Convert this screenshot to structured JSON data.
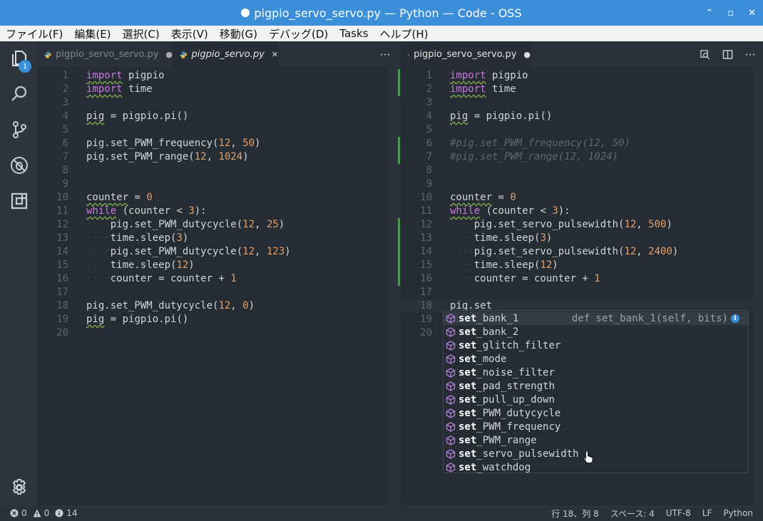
{
  "window": {
    "title": "pigpio_servo_servo.py — Python — Code - OSS",
    "controls": [
      "⌃",
      "▫",
      "✕"
    ]
  },
  "menu": [
    "ファイル(F)",
    "編集(E)",
    "選択(C)",
    "表示(V)",
    "移動(G)",
    "デバッグ(D)",
    "Tasks",
    "ヘルプ(H)"
  ],
  "activity": {
    "explorer_badge": "1"
  },
  "left_group": {
    "tabs": [
      {
        "label": "pigpio_servo_servo.py",
        "state": "●",
        "active": false
      },
      {
        "label": "pigpio_servo.py",
        "state": "✕",
        "active": true
      }
    ],
    "more": "···",
    "lines": [
      {
        "n": "1",
        "segs": [
          {
            "t": "import",
            "c": "kw sq"
          },
          {
            "t": " pigpio",
            "c": ""
          }
        ]
      },
      {
        "n": "2",
        "segs": [
          {
            "t": "import",
            "c": "kw sq"
          },
          {
            "t": " time",
            "c": ""
          }
        ]
      },
      {
        "n": "3",
        "segs": []
      },
      {
        "n": "4",
        "segs": [
          {
            "t": "pig",
            "c": "sq"
          },
          {
            "t": " = pigpio.pi()",
            "c": ""
          }
        ]
      },
      {
        "n": "5",
        "segs": []
      },
      {
        "n": "6",
        "segs": [
          {
            "t": "pig.set_PWM_frequency(",
            "c": ""
          },
          {
            "t": "12",
            "c": "num"
          },
          {
            "t": ", ",
            "c": ""
          },
          {
            "t": "50",
            "c": "num"
          },
          {
            "t": ")",
            "c": ""
          }
        ]
      },
      {
        "n": "7",
        "segs": [
          {
            "t": "pig.set_PWM_range(",
            "c": ""
          },
          {
            "t": "12",
            "c": "num"
          },
          {
            "t": ", ",
            "c": ""
          },
          {
            "t": "1024",
            "c": "num"
          },
          {
            "t": ")",
            "c": ""
          }
        ]
      },
      {
        "n": "8",
        "segs": []
      },
      {
        "n": "9",
        "segs": []
      },
      {
        "n": "10",
        "segs": [
          {
            "t": "counter",
            "c": "sq"
          },
          {
            "t": " = ",
            "c": ""
          },
          {
            "t": "0",
            "c": "num"
          }
        ]
      },
      {
        "n": "11",
        "segs": [
          {
            "t": "while",
            "c": "kw sq"
          },
          {
            "t": " (counter < ",
            "c": ""
          },
          {
            "t": "3",
            "c": "num"
          },
          {
            "t": "):",
            "c": ""
          }
        ]
      },
      {
        "n": "12",
        "segs": [
          {
            "t": "····",
            "c": "indent-guide"
          },
          {
            "t": "pig.set_PWM_dutycycle(",
            "c": ""
          },
          {
            "t": "12",
            "c": "num"
          },
          {
            "t": ", ",
            "c": ""
          },
          {
            "t": "25",
            "c": "num"
          },
          {
            "t": ")",
            "c": ""
          }
        ]
      },
      {
        "n": "13",
        "segs": [
          {
            "t": "····",
            "c": "indent-guide"
          },
          {
            "t": "time.sleep(",
            "c": ""
          },
          {
            "t": "3",
            "c": "num"
          },
          {
            "t": ")",
            "c": ""
          }
        ]
      },
      {
        "n": "14",
        "segs": [
          {
            "t": "····",
            "c": "indent-guide"
          },
          {
            "t": "pig.set_PWM_dutycycle(",
            "c": ""
          },
          {
            "t": "12",
            "c": "num"
          },
          {
            "t": ", ",
            "c": ""
          },
          {
            "t": "123",
            "c": "num"
          },
          {
            "t": ")",
            "c": ""
          }
        ]
      },
      {
        "n": "15",
        "segs": [
          {
            "t": "····",
            "c": "indent-guide"
          },
          {
            "t": "time.sleep(",
            "c": ""
          },
          {
            "t": "12",
            "c": "num"
          },
          {
            "t": ")",
            "c": ""
          }
        ]
      },
      {
        "n": "16",
        "segs": [
          {
            "t": "····",
            "c": "indent-guide"
          },
          {
            "t": "counter = counter + ",
            "c": ""
          },
          {
            "t": "1",
            "c": "num"
          }
        ]
      },
      {
        "n": "17",
        "segs": []
      },
      {
        "n": "18",
        "segs": [
          {
            "t": "pig.set_PWM_dutycycle(",
            "c": ""
          },
          {
            "t": "12",
            "c": "num"
          },
          {
            "t": ", ",
            "c": ""
          },
          {
            "t": "0",
            "c": "num"
          },
          {
            "t": ")",
            "c": ""
          }
        ]
      },
      {
        "n": "19",
        "segs": [
          {
            "t": "pig",
            "c": "sq"
          },
          {
            "t": " = pigpio.pi()",
            "c": ""
          }
        ]
      },
      {
        "n": "20",
        "segs": []
      }
    ]
  },
  "right_group": {
    "tabs": [
      {
        "label": "pigpio_servo_servo.py",
        "state": "●",
        "active": true
      }
    ],
    "more": "···",
    "lines": [
      {
        "n": "1",
        "segs": [
          {
            "t": "import",
            "c": "kw sq"
          },
          {
            "t": " pigpio",
            "c": ""
          }
        ]
      },
      {
        "n": "2",
        "segs": [
          {
            "t": "import",
            "c": "kw sq"
          },
          {
            "t": " time",
            "c": ""
          }
        ]
      },
      {
        "n": "3",
        "segs": []
      },
      {
        "n": "4",
        "segs": [
          {
            "t": "pig",
            "c": "sq"
          },
          {
            "t": " = pigpio.pi()",
            "c": ""
          }
        ]
      },
      {
        "n": "5",
        "segs": []
      },
      {
        "n": "6",
        "segs": [
          {
            "t": "#pig.set_PWM_frequency(12, 50)",
            "c": "cm"
          }
        ]
      },
      {
        "n": "7",
        "segs": [
          {
            "t": "#pig.set_PWM_range(12, 1024)",
            "c": "cm"
          }
        ]
      },
      {
        "n": "8",
        "segs": []
      },
      {
        "n": "9",
        "segs": []
      },
      {
        "n": "10",
        "segs": [
          {
            "t": "counter",
            "c": "sq"
          },
          {
            "t": " = ",
            "c": ""
          },
          {
            "t": "0",
            "c": "num"
          }
        ]
      },
      {
        "n": "11",
        "segs": [
          {
            "t": "while",
            "c": "kw sq"
          },
          {
            "t": " (counter < ",
            "c": ""
          },
          {
            "t": "3",
            "c": "num"
          },
          {
            "t": "):",
            "c": ""
          }
        ]
      },
      {
        "n": "12",
        "segs": [
          {
            "t": "····",
            "c": "indent-guide"
          },
          {
            "t": "pig.set_servo_pulsewidth(",
            "c": ""
          },
          {
            "t": "12",
            "c": "num"
          },
          {
            "t": ", ",
            "c": ""
          },
          {
            "t": "500",
            "c": "num"
          },
          {
            "t": ")",
            "c": ""
          }
        ]
      },
      {
        "n": "13",
        "segs": [
          {
            "t": "····",
            "c": "indent-guide"
          },
          {
            "t": "time.sleep(",
            "c": ""
          },
          {
            "t": "3",
            "c": "num"
          },
          {
            "t": ")",
            "c": ""
          }
        ]
      },
      {
        "n": "14",
        "segs": [
          {
            "t": "····",
            "c": "indent-guide"
          },
          {
            "t": "pig.set_servo_pulsewidth(",
            "c": ""
          },
          {
            "t": "12",
            "c": "num"
          },
          {
            "t": ", ",
            "c": ""
          },
          {
            "t": "2400",
            "c": "num"
          },
          {
            "t": ")",
            "c": ""
          }
        ]
      },
      {
        "n": "15",
        "segs": [
          {
            "t": "····",
            "c": "indent-guide"
          },
          {
            "t": "time.sleep(",
            "c": ""
          },
          {
            "t": "12",
            "c": "num"
          },
          {
            "t": ")",
            "c": ""
          }
        ]
      },
      {
        "n": "16",
        "segs": [
          {
            "t": "····",
            "c": "indent-guide"
          },
          {
            "t": "counter = counter + ",
            "c": ""
          },
          {
            "t": "1",
            "c": "num"
          }
        ]
      },
      {
        "n": "17",
        "segs": []
      },
      {
        "n": "18",
        "segs": [
          {
            "t": "pig.set",
            "c": ""
          }
        ]
      },
      {
        "n": "19",
        "segs": []
      },
      {
        "n": "20",
        "segs": []
      }
    ]
  },
  "suggest": {
    "detail": "def set_bank_1(self, bits)",
    "info_icon": "i",
    "match": "set",
    "items": [
      "_bank_1",
      "_bank_2",
      "_glitch_filter",
      "_mode",
      "_noise_filter",
      "_pad_strength",
      "_pull_up_down",
      "_PWM_dutycycle",
      "_PWM_frequency",
      "_PWM_range",
      "_servo_pulsewidth",
      "_watchdog"
    ]
  },
  "status": {
    "errors": "0",
    "warnings": "0",
    "infos": "14",
    "position": "行 18、列 8",
    "spaces": "スペース: 4",
    "encoding": "UTF-8",
    "eol": "LF",
    "language": "Python"
  },
  "colors": {
    "accent": "#3b8fd9",
    "keyword": "#c678dd",
    "number": "#e4a06b",
    "squiggle": "#7aa64a",
    "icon_method": "#b180d7"
  }
}
